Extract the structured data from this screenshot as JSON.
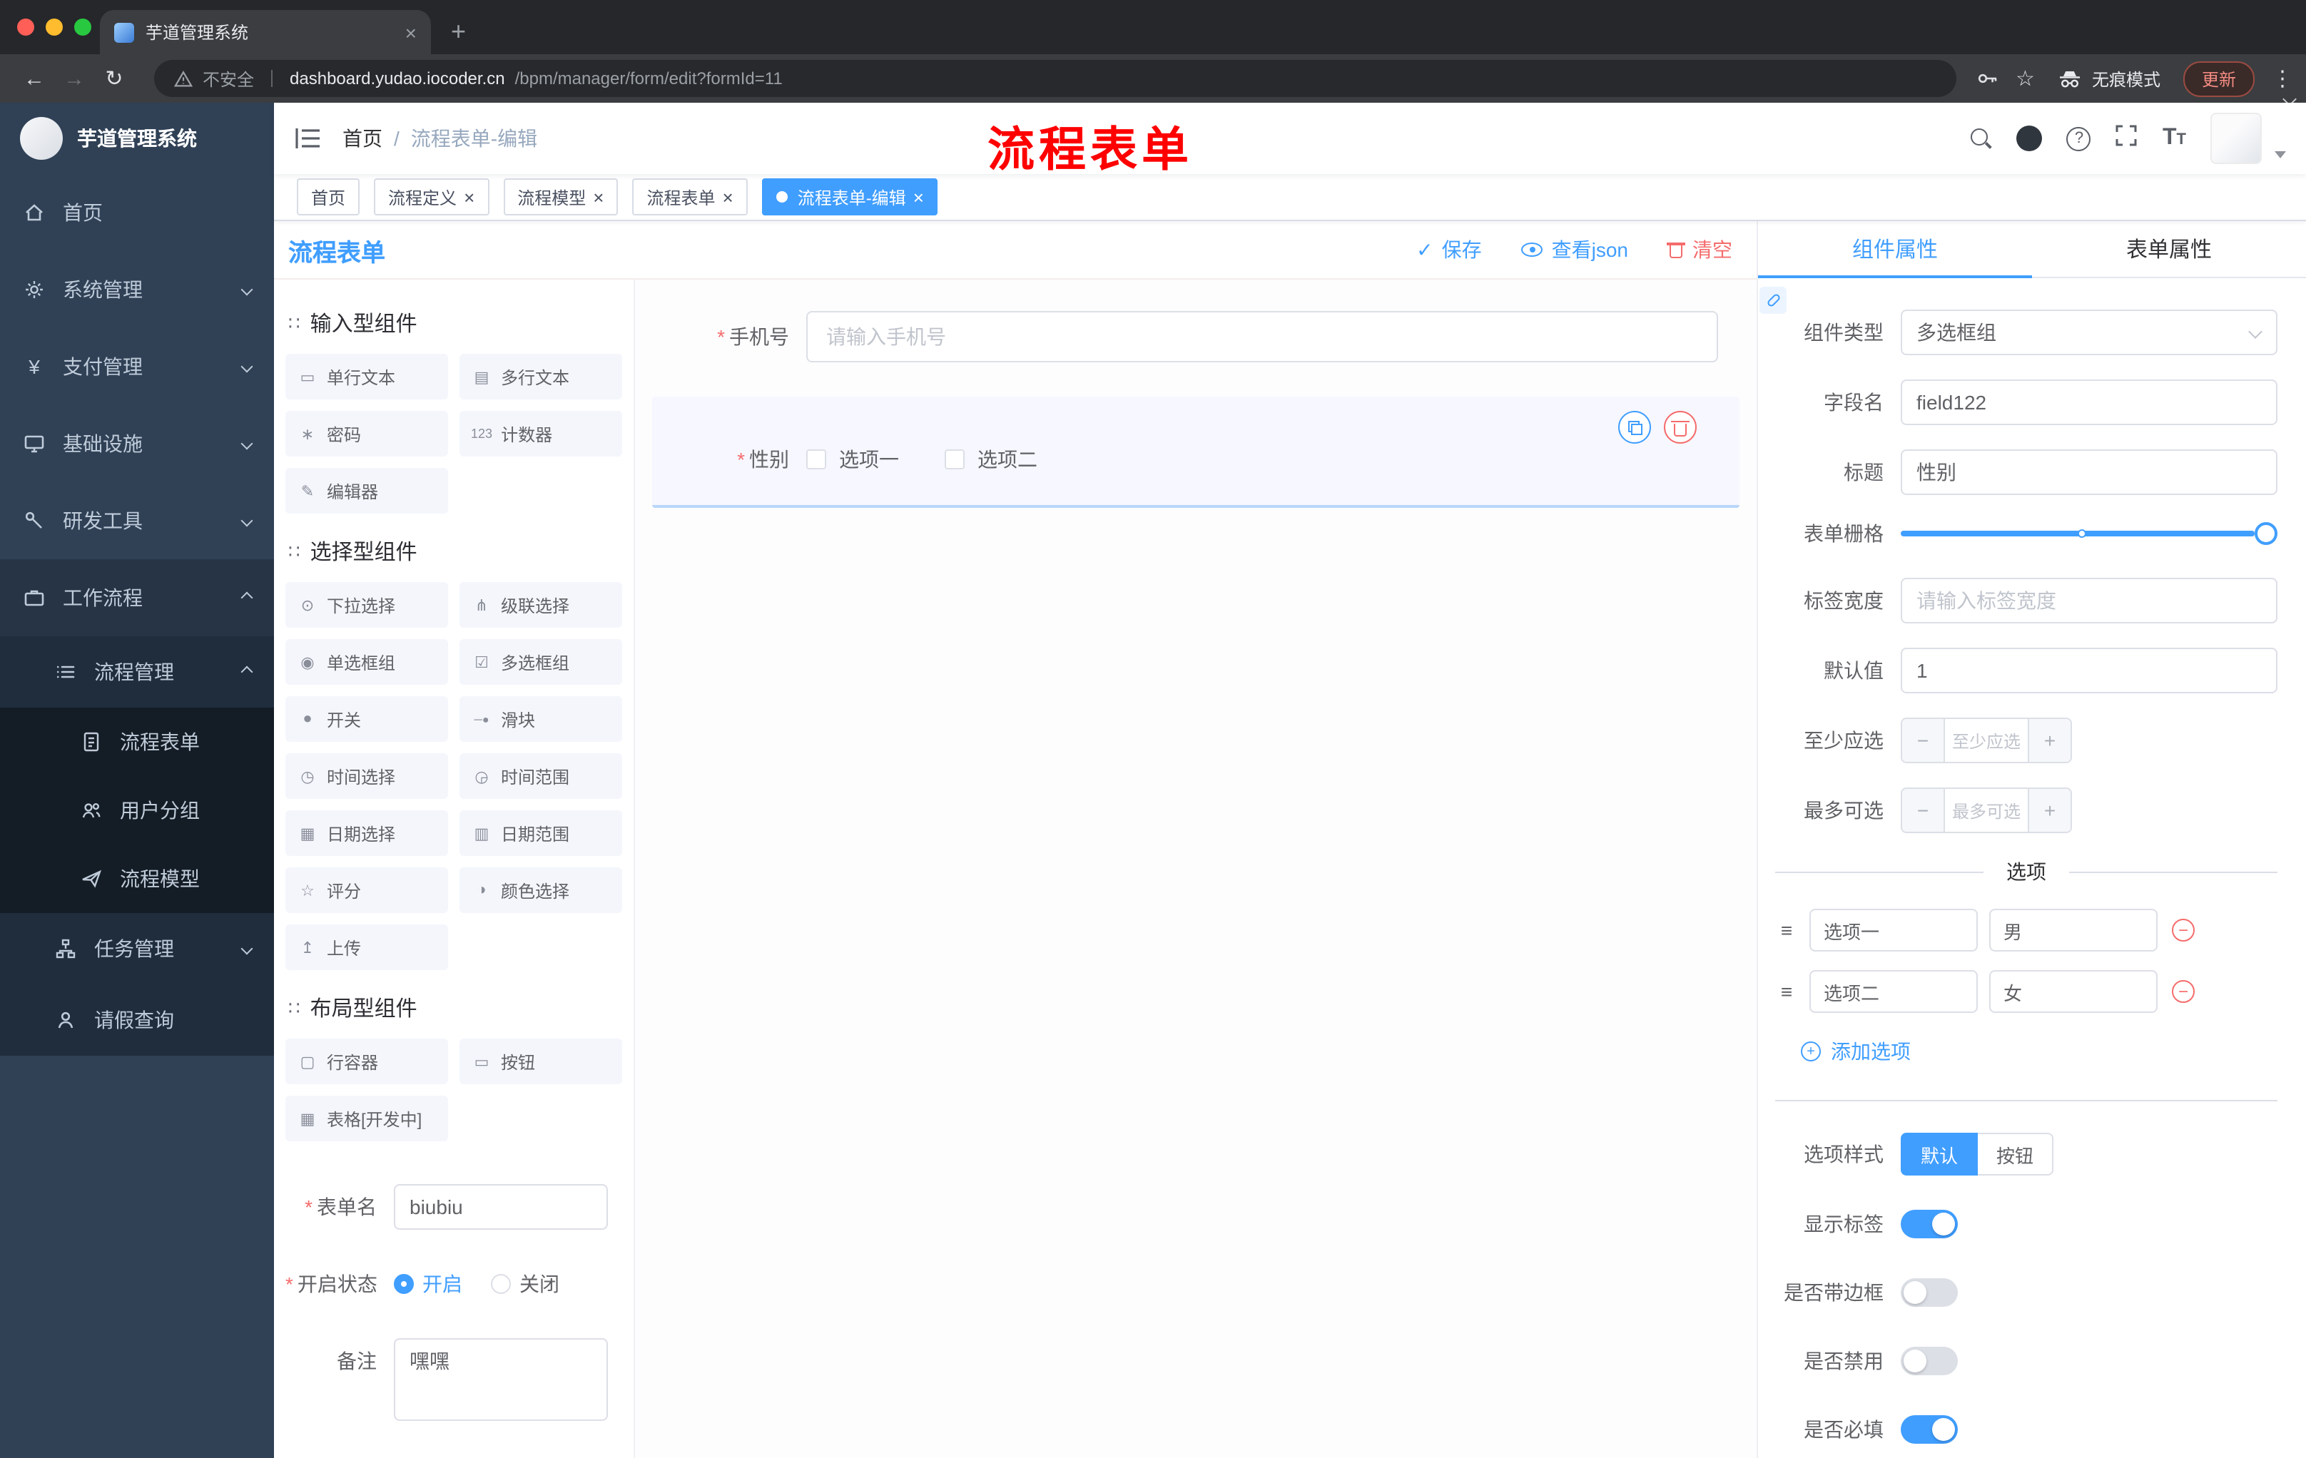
{
  "colors": {
    "accent": "#409eff",
    "danger": "#f56c6c",
    "annotation": "#fe0000",
    "sidebar_bg": "#304156"
  },
  "browser": {
    "tab_title": "芋道管理系统",
    "security": "不安全",
    "host": "dashboard.yudao.iocoder.cn",
    "path": "/bpm/manager/form/edit?formId=11",
    "incognito": "无痕模式",
    "update": "更新"
  },
  "sidebar": {
    "logo_title": "芋道管理系统",
    "items": [
      {
        "label": "首页"
      },
      {
        "label": "系统管理"
      },
      {
        "label": "支付管理"
      },
      {
        "label": "基础设施"
      },
      {
        "label": "研发工具"
      },
      {
        "label": "工作流程"
      },
      {
        "label": "流程管理"
      },
      {
        "label": "流程表单"
      },
      {
        "label": "用户分组"
      },
      {
        "label": "流程模型"
      },
      {
        "label": "任务管理"
      },
      {
        "label": "请假查询"
      }
    ]
  },
  "navbar": {
    "breadcrumb_home": "首页",
    "breadcrumb_sep": "/",
    "breadcrumb_current": "流程表单-编辑",
    "annotation": "流程表单"
  },
  "tags": [
    {
      "label": "首页"
    },
    {
      "label": "流程定义"
    },
    {
      "label": "流程模型"
    },
    {
      "label": "流程表单"
    },
    {
      "label": "流程表单-编辑"
    }
  ],
  "designer": {
    "title": "流程表单",
    "actions": {
      "save": "保存",
      "view_json": "查看json",
      "clear": "清空"
    },
    "groups": [
      {
        "title": "输入型组件"
      },
      {
        "title": "选择型组件"
      },
      {
        "title": "布局型组件"
      }
    ],
    "components": {
      "input": [
        {
          "icon": "▭",
          "label": "单行文本"
        },
        {
          "icon": "▤",
          "label": "多行文本"
        },
        {
          "icon": "∗",
          "label": "密码"
        },
        {
          "icon": "123",
          "label": "计数器"
        },
        {
          "icon": "✎",
          "label": "编辑器"
        }
      ],
      "select": [
        {
          "icon": "⊙",
          "label": "下拉选择"
        },
        {
          "icon": "⋔",
          "label": "级联选择"
        },
        {
          "icon": "◉",
          "label": "单选框组"
        },
        {
          "icon": "☑",
          "label": "多选框组"
        },
        {
          "icon": "●",
          "label": "开关"
        },
        {
          "icon": "─●",
          "label": "滑块"
        },
        {
          "icon": "◷",
          "label": "时间选择"
        },
        {
          "icon": "◶",
          "label": "时间范围"
        },
        {
          "icon": "▦",
          "label": "日期选择"
        },
        {
          "icon": "▥",
          "label": "日期范围"
        },
        {
          "icon": "☆",
          "label": "评分"
        },
        {
          "icon": "◑",
          "label": "颜色选择"
        },
        {
          "icon": "↥",
          "label": "上传"
        }
      ],
      "layout": [
        {
          "icon": "▢",
          "label": "行容器"
        },
        {
          "icon": "▭",
          "label": "按钮"
        },
        {
          "icon": "▦",
          "label": "表格[开发中]"
        }
      ]
    },
    "meta": {
      "name_label": "表单名",
      "name_value": "biubiu",
      "status_label": "开启状态",
      "status_on": "开启",
      "status_off": "关闭",
      "remark_label": "备注",
      "remark_value": "嘿嘿"
    },
    "canvas": {
      "phone_label": "手机号",
      "phone_placeholder": "请输入手机号",
      "gender_label": "性别",
      "gender_opt1": "选项一",
      "gender_opt2": "选项二"
    }
  },
  "props": {
    "tab_component": "组件属性",
    "tab_form": "表单属性",
    "type_label": "组件类型",
    "type_value": "多选框组",
    "field_label": "字段名",
    "field_value": "field122",
    "title_label": "标题",
    "title_value": "性别",
    "grid_label": "表单栅格",
    "labelwidth_label": "标签宽度",
    "labelwidth_placeholder": "请输入标签宽度",
    "default_label": "默认值",
    "default_value": "1",
    "min_label": "至少应选",
    "min_placeholder": "至少应选",
    "max_label": "最多可选",
    "max_placeholder": "最多可选",
    "options_divider": "选项",
    "options": [
      {
        "label": "选项一",
        "value": "男"
      },
      {
        "label": "选项二",
        "value": "女"
      }
    ],
    "add_option": "添加选项",
    "style_label": "选项样式",
    "style_default": "默认",
    "style_button": "按钮",
    "switches": [
      {
        "label": "显示标签",
        "on": true
      },
      {
        "label": "是否带边框",
        "on": false
      },
      {
        "label": "是否禁用",
        "on": false
      },
      {
        "label": "是否必填",
        "on": true
      }
    ]
  }
}
